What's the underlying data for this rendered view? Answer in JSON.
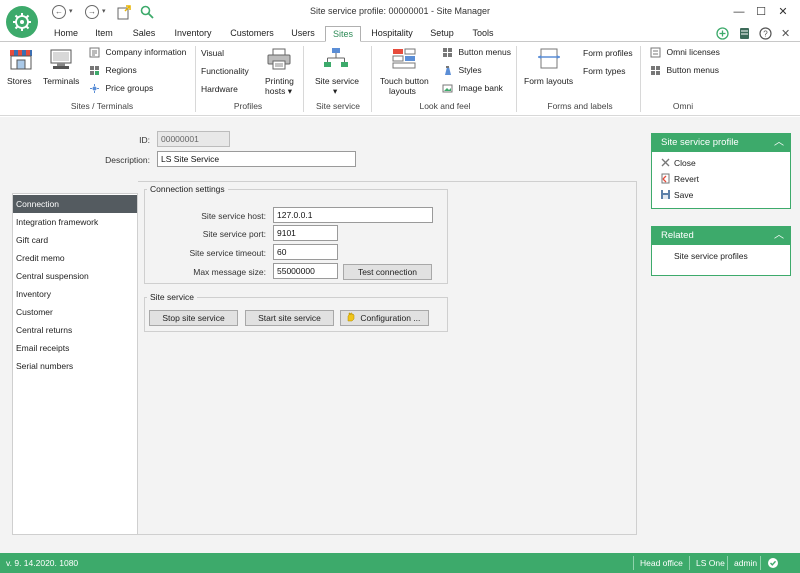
{
  "window": {
    "title": "Site service profile: 00000001 - Site Manager",
    "minimize": "—",
    "maximize": "☐",
    "close": "✕"
  },
  "toolbar": {
    "back": "←",
    "forward": "→"
  },
  "menu": {
    "tabs": [
      "Home",
      "Item",
      "Sales",
      "Inventory",
      "Customers",
      "Users",
      "Sites",
      "Hospitality",
      "Setup",
      "Tools"
    ],
    "active": "Sites"
  },
  "ribbon": {
    "stores": "Stores",
    "terminals": "Terminals",
    "company_information": "Company information",
    "regions": "Regions",
    "price_groups": "Price groups",
    "group_sites_terminals": "Sites / Terminals",
    "visual": "Visual",
    "functionality": "Functionality",
    "hardware": "Hardware",
    "printing_hosts_1": "Printing",
    "printing_hosts_2": "hosts",
    "group_profiles": "Profiles",
    "site_service": "Site service",
    "group_site_service": "Site service",
    "touch_button_layouts_1": "Touch button",
    "touch_button_layouts_2": "layouts",
    "button_menus": "Button menus",
    "styles": "Styles",
    "image_bank": "Image bank",
    "group_look_and_feel": "Look and feel",
    "form_layouts": "Form layouts",
    "form_profiles": "Form profiles",
    "form_types": "Form types",
    "group_forms_labels": "Forms and labels",
    "omni_licenses": "Omni licenses",
    "omni_button_menus": "Button menus",
    "group_omni": "Omni"
  },
  "form": {
    "id_label": "ID:",
    "id_value": "00000001",
    "description_label": "Description:",
    "description_value": "LS Site Service"
  },
  "nav": {
    "items": [
      "Connection",
      "Integration framework",
      "Gift card",
      "Credit  memo",
      "Central suspension",
      "Inventory",
      "Customer",
      "Central returns",
      "Email receipts",
      "Serial numbers"
    ],
    "active": "Connection"
  },
  "connection": {
    "title": "Connection settings",
    "host_label": "Site service host:",
    "host_value": "127.0.0.1",
    "port_label": "Site service port:",
    "port_value": "9101",
    "timeout_label": "Site service timeout:",
    "timeout_value": "60",
    "maxmsg_label": "Max message size:",
    "maxmsg_value": "55000000",
    "test_button": "Test connection"
  },
  "site_service": {
    "title": "Site service",
    "stop_button": "Stop site service",
    "start_button": "Start site service",
    "config_button": "Configuration ..."
  },
  "profile_card": {
    "title": "Site service profile",
    "close": "Close",
    "revert": "Revert",
    "save": "Save"
  },
  "related_card": {
    "title": "Related",
    "link": "Site service profiles"
  },
  "status": {
    "version": "v. 9. 14.2020. 1080",
    "store": "Head office",
    "product": "LS One",
    "user": "admin"
  },
  "colors": {
    "brand_green": "#3daa6b",
    "nav_active": "#545b60"
  }
}
